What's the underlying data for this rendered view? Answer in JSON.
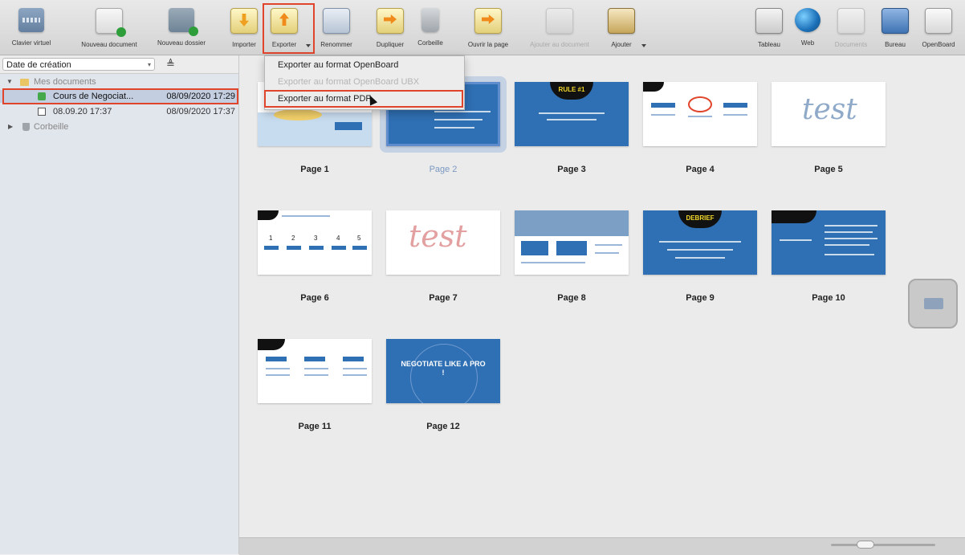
{
  "toolbar": {
    "buttons": [
      {
        "label": "Clavier virtuel"
      },
      {
        "label": "Nouveau document"
      },
      {
        "label": "Nouveau dossier"
      },
      {
        "label": "Importer"
      },
      {
        "label": "Exporter"
      },
      {
        "label": "Renommer"
      },
      {
        "label": "Dupliquer"
      },
      {
        "label": "Corbeille"
      },
      {
        "label": "Ouvrir la page"
      },
      {
        "label": "Ajouter au document"
      },
      {
        "label": "Ajouter"
      },
      {
        "label": "Tableau"
      },
      {
        "label": "Web"
      },
      {
        "label": "Documents"
      },
      {
        "label": "Bureau"
      },
      {
        "label": "OpenBoard"
      }
    ]
  },
  "export_menu": {
    "items": [
      {
        "label": "Exporter au format OpenBoard",
        "enabled": true
      },
      {
        "label": "Exporter au format OpenBoard UBX",
        "enabled": false
      },
      {
        "label": "Exporter au format PDF",
        "enabled": true
      }
    ]
  },
  "sidebar": {
    "sort_by": "Date de création",
    "tree": {
      "folder": "Mes documents",
      "documents": [
        {
          "name": "Cours de Negociat...",
          "date": "08/09/2020 17:29"
        },
        {
          "name": "08.09.20 17:37",
          "date": "08/09/2020 17:37"
        }
      ],
      "trash": "Corbeille"
    }
  },
  "pages": [
    {
      "label": "Page 1"
    },
    {
      "label": "Page 2"
    },
    {
      "label": "Page 3",
      "badge": "RULE #1"
    },
    {
      "label": "Page 4"
    },
    {
      "label": "Page 5",
      "scribble": "test"
    },
    {
      "label": "Page 6",
      "steps": [
        "1",
        "2",
        "3",
        "4",
        "5"
      ]
    },
    {
      "label": "Page 7",
      "scribble": "test"
    },
    {
      "label": "Page 8"
    },
    {
      "label": "Page 9",
      "badge": "DEBRIEF"
    },
    {
      "label": "Page 10"
    },
    {
      "label": "Page 11"
    },
    {
      "label": "Page 12",
      "title": "NEGOTIATE LIKE A PRO !"
    }
  ],
  "selected_page": "Page 2",
  "colors": {
    "highlight": "#e0452c",
    "slide_blue": "#2f6fb3",
    "selection": "#c3cee0"
  }
}
